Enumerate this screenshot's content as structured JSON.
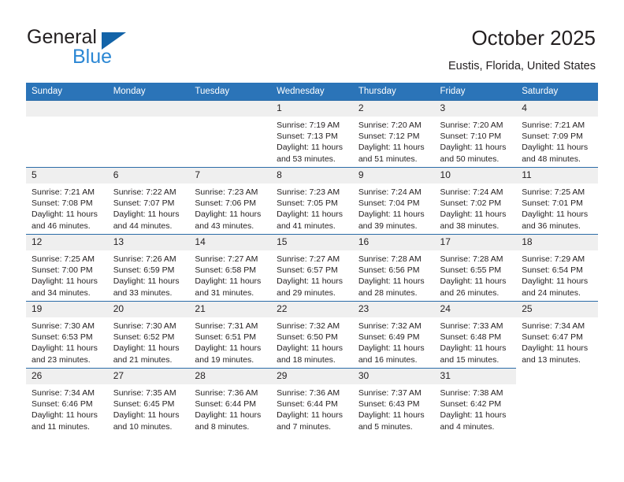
{
  "brand": {
    "name_part1": "General",
    "name_part2": "Blue",
    "triangle_color": "#1263a8",
    "blue_color": "#2b87d4"
  },
  "header": {
    "title": "October 2025",
    "subtitle": "Eustis, Florida, United States"
  },
  "theme": {
    "header_bg": "#2b74b8",
    "header_text": "#ffffff",
    "row_divider": "#2b6ca8",
    "daynum_bg": "#efefef",
    "text": "#231f20"
  },
  "calendar": {
    "weekday_headers": [
      "Sunday",
      "Monday",
      "Tuesday",
      "Wednesday",
      "Thursday",
      "Friday",
      "Saturday"
    ],
    "weeks": [
      [
        {
          "day": "",
          "blank": true
        },
        {
          "day": "",
          "blank": true
        },
        {
          "day": "",
          "blank": true
        },
        {
          "day": "1",
          "sunrise": "Sunrise: 7:19 AM",
          "sunset": "Sunset: 7:13 PM",
          "daylight_line1": "Daylight: 11 hours",
          "daylight_line2": "and 53 minutes."
        },
        {
          "day": "2",
          "sunrise": "Sunrise: 7:20 AM",
          "sunset": "Sunset: 7:12 PM",
          "daylight_line1": "Daylight: 11 hours",
          "daylight_line2": "and 51 minutes."
        },
        {
          "day": "3",
          "sunrise": "Sunrise: 7:20 AM",
          "sunset": "Sunset: 7:10 PM",
          "daylight_line1": "Daylight: 11 hours",
          "daylight_line2": "and 50 minutes."
        },
        {
          "day": "4",
          "sunrise": "Sunrise: 7:21 AM",
          "sunset": "Sunset: 7:09 PM",
          "daylight_line1": "Daylight: 11 hours",
          "daylight_line2": "and 48 minutes."
        }
      ],
      [
        {
          "day": "5",
          "sunrise": "Sunrise: 7:21 AM",
          "sunset": "Sunset: 7:08 PM",
          "daylight_line1": "Daylight: 11 hours",
          "daylight_line2": "and 46 minutes."
        },
        {
          "day": "6",
          "sunrise": "Sunrise: 7:22 AM",
          "sunset": "Sunset: 7:07 PM",
          "daylight_line1": "Daylight: 11 hours",
          "daylight_line2": "and 44 minutes."
        },
        {
          "day": "7",
          "sunrise": "Sunrise: 7:23 AM",
          "sunset": "Sunset: 7:06 PM",
          "daylight_line1": "Daylight: 11 hours",
          "daylight_line2": "and 43 minutes."
        },
        {
          "day": "8",
          "sunrise": "Sunrise: 7:23 AM",
          "sunset": "Sunset: 7:05 PM",
          "daylight_line1": "Daylight: 11 hours",
          "daylight_line2": "and 41 minutes."
        },
        {
          "day": "9",
          "sunrise": "Sunrise: 7:24 AM",
          "sunset": "Sunset: 7:04 PM",
          "daylight_line1": "Daylight: 11 hours",
          "daylight_line2": "and 39 minutes."
        },
        {
          "day": "10",
          "sunrise": "Sunrise: 7:24 AM",
          "sunset": "Sunset: 7:02 PM",
          "daylight_line1": "Daylight: 11 hours",
          "daylight_line2": "and 38 minutes."
        },
        {
          "day": "11",
          "sunrise": "Sunrise: 7:25 AM",
          "sunset": "Sunset: 7:01 PM",
          "daylight_line1": "Daylight: 11 hours",
          "daylight_line2": "and 36 minutes."
        }
      ],
      [
        {
          "day": "12",
          "sunrise": "Sunrise: 7:25 AM",
          "sunset": "Sunset: 7:00 PM",
          "daylight_line1": "Daylight: 11 hours",
          "daylight_line2": "and 34 minutes."
        },
        {
          "day": "13",
          "sunrise": "Sunrise: 7:26 AM",
          "sunset": "Sunset: 6:59 PM",
          "daylight_line1": "Daylight: 11 hours",
          "daylight_line2": "and 33 minutes."
        },
        {
          "day": "14",
          "sunrise": "Sunrise: 7:27 AM",
          "sunset": "Sunset: 6:58 PM",
          "daylight_line1": "Daylight: 11 hours",
          "daylight_line2": "and 31 minutes."
        },
        {
          "day": "15",
          "sunrise": "Sunrise: 7:27 AM",
          "sunset": "Sunset: 6:57 PM",
          "daylight_line1": "Daylight: 11 hours",
          "daylight_line2": "and 29 minutes."
        },
        {
          "day": "16",
          "sunrise": "Sunrise: 7:28 AM",
          "sunset": "Sunset: 6:56 PM",
          "daylight_line1": "Daylight: 11 hours",
          "daylight_line2": "and 28 minutes."
        },
        {
          "day": "17",
          "sunrise": "Sunrise: 7:28 AM",
          "sunset": "Sunset: 6:55 PM",
          "daylight_line1": "Daylight: 11 hours",
          "daylight_line2": "and 26 minutes."
        },
        {
          "day": "18",
          "sunrise": "Sunrise: 7:29 AM",
          "sunset": "Sunset: 6:54 PM",
          "daylight_line1": "Daylight: 11 hours",
          "daylight_line2": "and 24 minutes."
        }
      ],
      [
        {
          "day": "19",
          "sunrise": "Sunrise: 7:30 AM",
          "sunset": "Sunset: 6:53 PM",
          "daylight_line1": "Daylight: 11 hours",
          "daylight_line2": "and 23 minutes."
        },
        {
          "day": "20",
          "sunrise": "Sunrise: 7:30 AM",
          "sunset": "Sunset: 6:52 PM",
          "daylight_line1": "Daylight: 11 hours",
          "daylight_line2": "and 21 minutes."
        },
        {
          "day": "21",
          "sunrise": "Sunrise: 7:31 AM",
          "sunset": "Sunset: 6:51 PM",
          "daylight_line1": "Daylight: 11 hours",
          "daylight_line2": "and 19 minutes."
        },
        {
          "day": "22",
          "sunrise": "Sunrise: 7:32 AM",
          "sunset": "Sunset: 6:50 PM",
          "daylight_line1": "Daylight: 11 hours",
          "daylight_line2": "and 18 minutes."
        },
        {
          "day": "23",
          "sunrise": "Sunrise: 7:32 AM",
          "sunset": "Sunset: 6:49 PM",
          "daylight_line1": "Daylight: 11 hours",
          "daylight_line2": "and 16 minutes."
        },
        {
          "day": "24",
          "sunrise": "Sunrise: 7:33 AM",
          "sunset": "Sunset: 6:48 PM",
          "daylight_line1": "Daylight: 11 hours",
          "daylight_line2": "and 15 minutes."
        },
        {
          "day": "25",
          "sunrise": "Sunrise: 7:34 AM",
          "sunset": "Sunset: 6:47 PM",
          "daylight_line1": "Daylight: 11 hours",
          "daylight_line2": "and 13 minutes."
        }
      ],
      [
        {
          "day": "26",
          "sunrise": "Sunrise: 7:34 AM",
          "sunset": "Sunset: 6:46 PM",
          "daylight_line1": "Daylight: 11 hours",
          "daylight_line2": "and 11 minutes."
        },
        {
          "day": "27",
          "sunrise": "Sunrise: 7:35 AM",
          "sunset": "Sunset: 6:45 PM",
          "daylight_line1": "Daylight: 11 hours",
          "daylight_line2": "and 10 minutes."
        },
        {
          "day": "28",
          "sunrise": "Sunrise: 7:36 AM",
          "sunset": "Sunset: 6:44 PM",
          "daylight_line1": "Daylight: 11 hours",
          "daylight_line2": "and 8 minutes."
        },
        {
          "day": "29",
          "sunrise": "Sunrise: 7:36 AM",
          "sunset": "Sunset: 6:44 PM",
          "daylight_line1": "Daylight: 11 hours",
          "daylight_line2": "and 7 minutes."
        },
        {
          "day": "30",
          "sunrise": "Sunrise: 7:37 AM",
          "sunset": "Sunset: 6:43 PM",
          "daylight_line1": "Daylight: 11 hours",
          "daylight_line2": "and 5 minutes."
        },
        {
          "day": "31",
          "sunrise": "Sunrise: 7:38 AM",
          "sunset": "Sunset: 6:42 PM",
          "daylight_line1": "Daylight: 11 hours",
          "daylight_line2": "and 4 minutes."
        },
        {
          "day": "",
          "none": true
        }
      ]
    ]
  }
}
